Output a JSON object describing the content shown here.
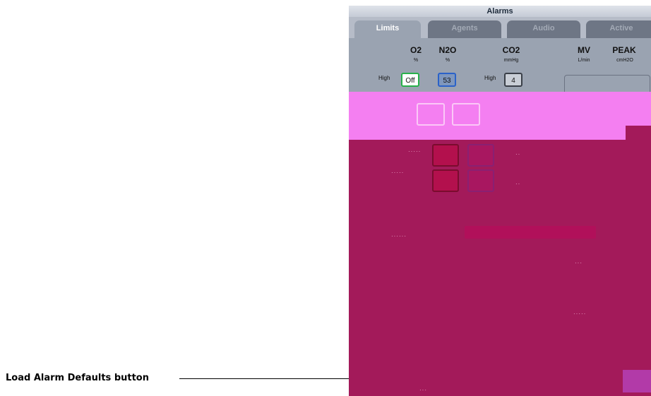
{
  "callout": {
    "label": "Load Alarm Defaults button"
  },
  "window": {
    "title": "Alarms"
  },
  "tabs": [
    {
      "label": "Limits",
      "active": true
    },
    {
      "label": "Agents",
      "active": false
    },
    {
      "label": "Audio",
      "active": false
    },
    {
      "label": "Active",
      "active": false
    }
  ],
  "columns": [
    {
      "name": "O2",
      "unit": "%"
    },
    {
      "name": "N2O",
      "unit": "%"
    },
    {
      "name": "CO2",
      "unit": "mmHg"
    },
    {
      "name": "MV",
      "unit": "L/min"
    },
    {
      "name": "PEAK",
      "unit": "cmH2O"
    }
  ],
  "row_labels": {
    "o2_high": "High",
    "co2_high": "High"
  },
  "values": {
    "o2_high": "Off",
    "n2o_high": "53",
    "co2_high": "4"
  },
  "colors": {
    "screen_bg": "#a31a5a",
    "pink_band": "#f47ff1",
    "o2_border": "#27b04a",
    "n2o_border": "#2a62c9"
  }
}
